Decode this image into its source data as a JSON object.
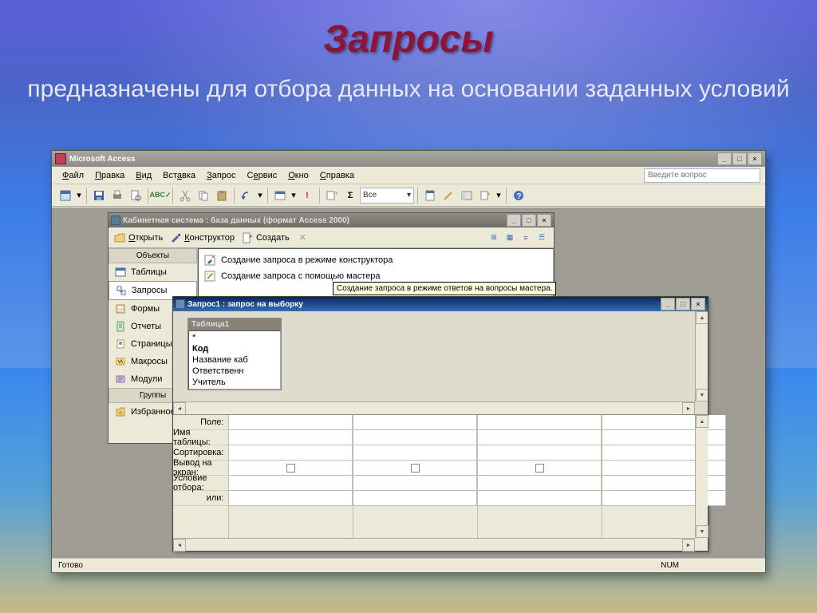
{
  "slide": {
    "title": "Запросы",
    "subtitle": "предназначены для отбора данных на основании заданных условий"
  },
  "app": {
    "title": "Microsoft Access",
    "help_placeholder": "Введите вопрос",
    "status": "Готово",
    "status_mode": "NUM"
  },
  "menus": [
    "Файл",
    "Правка",
    "Вид",
    "Вставка",
    "Запрос",
    "Сервис",
    "Окно",
    "Справка"
  ],
  "toolbar": {
    "return_label": "Все"
  },
  "db": {
    "title": "Кабинетная система : база данных (формат Access 2000)",
    "open": "Открыть",
    "design": "Конструктор",
    "create": "Создать",
    "section_objects": "Объекты",
    "section_groups": "Группы",
    "nav": {
      "tables": "Таблицы",
      "queries": "Запросы",
      "forms": "Формы",
      "reports": "Отчеты",
      "pages": "Страницы",
      "macros": "Макросы",
      "modules": "Модули",
      "fav": "Избранное"
    },
    "list": {
      "design": "Создание запроса в режиме конструктора",
      "wizard": "Создание запроса с помощью мастера"
    },
    "tooltip": "Создание запроса в режиме ответов на вопросы мастера."
  },
  "query": {
    "title": "Запрос1 : запрос на выборку",
    "table_name": "Таблица1",
    "fields": [
      "*",
      "Код",
      "Название каб",
      "Ответственн",
      "Учитель"
    ],
    "grid_labels": {
      "field": "Поле:",
      "table": "Имя таблицы:",
      "sort": "Сортировка:",
      "show": "Вывод на экран:",
      "criteria": "Условие отбора:",
      "or": "или:"
    }
  }
}
